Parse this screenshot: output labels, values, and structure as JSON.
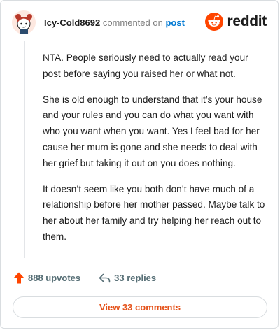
{
  "header": {
    "username": "Icy-Cold8692",
    "action_text": "commented on",
    "post_link": "post",
    "brand": "reddit"
  },
  "comment": {
    "paragraphs": [
      "NTA. People seriously need to actually read your post before saying you raised her or what not.",
      "She is old enough to understand that it’s your house and your rules and you can do what you want with who you want when you want. Yes I feel bad for her cause her mum is gone and she needs to deal with her grief but taking it out on you does nothing.",
      "It doesn’t seem like you both don’t have much of a relationship before her mother passed. Maybe talk to her about her family and try helping her reach out to them."
    ]
  },
  "stats": {
    "upvotes": "888 upvotes",
    "replies": "33 replies"
  },
  "footer": {
    "view_comments": "View 33 comments"
  },
  "colors": {
    "reddit_orange": "#ff4500",
    "link_blue": "#0079d3",
    "button_text": "#e5521a",
    "muted": "#576f76"
  },
  "icons": [
    "avatar-image",
    "reddit-logo-icon",
    "upvote-arrow-icon",
    "reply-arrow-icon"
  ]
}
